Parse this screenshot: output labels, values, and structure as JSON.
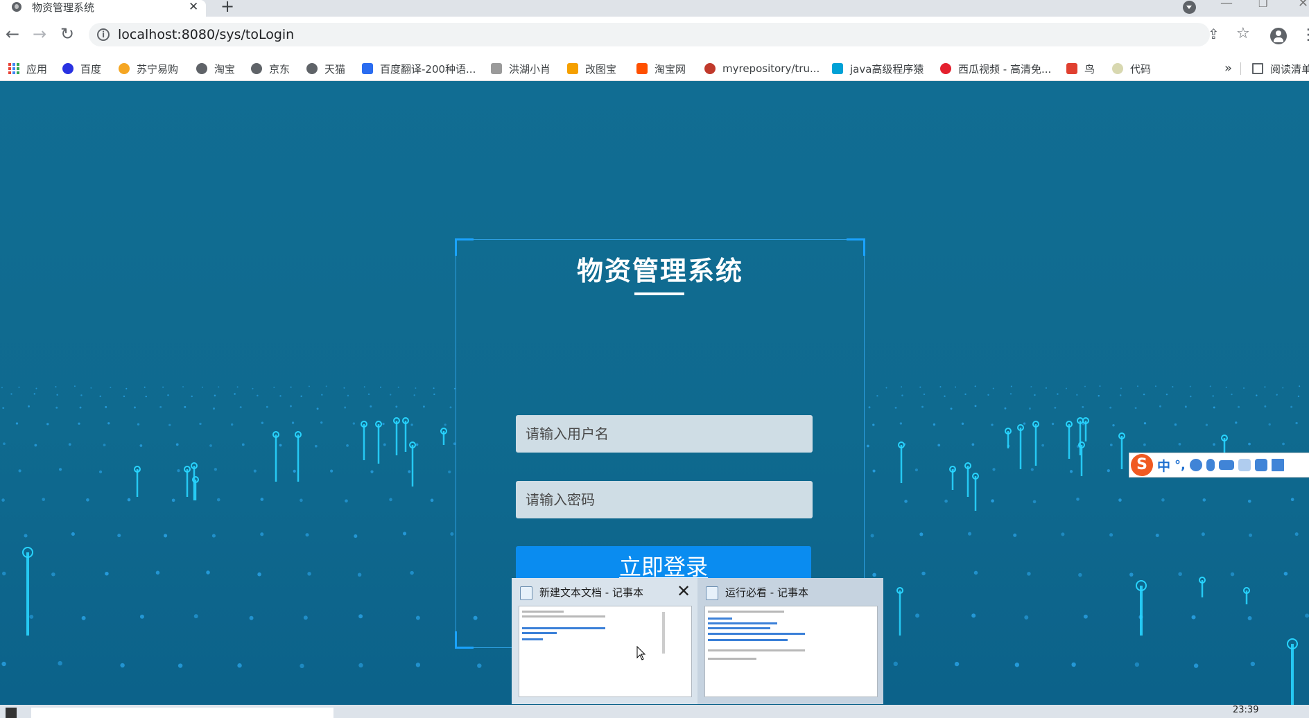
{
  "browser": {
    "tab": {
      "title": "物资管理系统",
      "close": "✕"
    },
    "new_tab": "+",
    "window_controls": {
      "minimize": "—",
      "restore": "❐",
      "close": "✕"
    },
    "nav": {
      "back": "←",
      "forward": "→",
      "reload": "↻"
    },
    "address": {
      "url": "localhost:8080/sys/toLogin",
      "info": "i"
    },
    "actions": {
      "share": "⇪",
      "bookmark_star": "☆",
      "menu": "⋮"
    },
    "bookmarks": [
      {
        "label": "应用",
        "icon": "apps-grid-icon",
        "color": "#e94235"
      },
      {
        "label": "百度",
        "icon": "baidu-paw-icon",
        "color": "#2932e1"
      },
      {
        "label": "苏宁易购",
        "icon": "suning-lion-icon",
        "color": "#f5a623"
      },
      {
        "label": "淘宝",
        "icon": "globe-icon",
        "color": "#5f6368"
      },
      {
        "label": "京东",
        "icon": "globe-icon",
        "color": "#5f6368"
      },
      {
        "label": "天猫",
        "icon": "globe-icon",
        "color": "#5f6368"
      },
      {
        "label": "百度翻译-200种语...",
        "icon": "translate-icon",
        "color": "#2a6cf0"
      },
      {
        "label": "洪湖小肖",
        "icon": "feather-icon",
        "color": "#8a8a8a"
      },
      {
        "label": "改图宝",
        "icon": "folder-icon",
        "color": "#f5a000"
      },
      {
        "label": "淘宝网",
        "icon": "taobao-icon",
        "color": "#ff5000"
      },
      {
        "label": "myrepository/tru...",
        "icon": "repo-icon",
        "color": "#c0392b"
      },
      {
        "label": "java高级程序猿",
        "icon": "bilibili-icon",
        "color": "#00a1d6"
      },
      {
        "label": "西瓜视频 - 高清免...",
        "icon": "xigua-icon",
        "color": "#e4202e"
      },
      {
        "label": "鸟",
        "icon": "bird-icon",
        "color": "#e04030"
      },
      {
        "label": "代码",
        "icon": "leaf-icon",
        "color": "#c8c8a0"
      }
    ],
    "bookmarks_more": "»",
    "reading_list": "阅读清单"
  },
  "login": {
    "title": "物资管理系统",
    "username_placeholder": "请输入用户名",
    "password_placeholder": "请输入密码",
    "submit_label": "立即登录"
  },
  "ime": {
    "logo": "S",
    "mode": "中",
    "punct": "°,"
  },
  "taskbar_previews": [
    {
      "title": "新建文本文档 - 记事本",
      "close": "✕"
    },
    {
      "title": "运行必看 - 记事本"
    }
  ],
  "taskbar": {
    "clock": "23:39"
  },
  "colors": {
    "page_bg": "#0f6a92",
    "accent_button": "#0a8cf0",
    "frame_border": "#2d9fe0",
    "glow": "#28d4ff"
  }
}
